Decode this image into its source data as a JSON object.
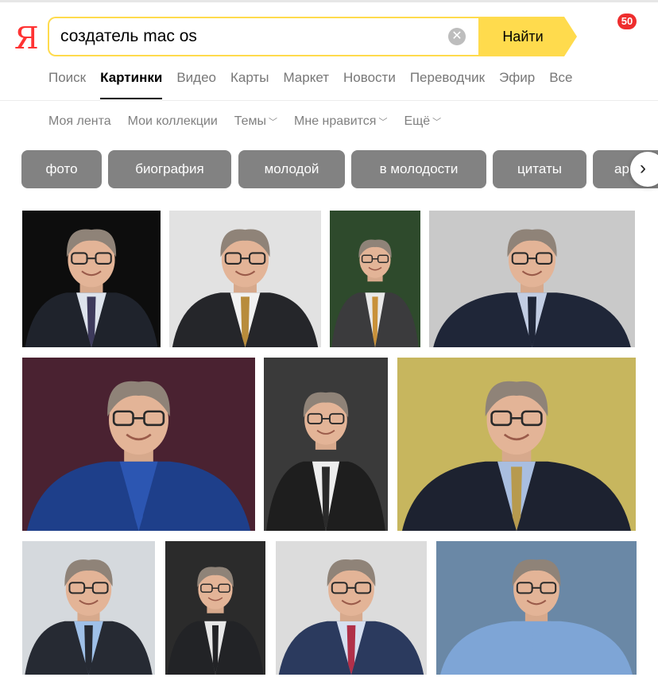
{
  "logo": "Я",
  "search": {
    "value": "создатель mac os",
    "button_label": "Найти"
  },
  "notifications": {
    "count": "50"
  },
  "tabs": [
    {
      "label": "Поиск",
      "active": false
    },
    {
      "label": "Картинки",
      "active": true
    },
    {
      "label": "Видео",
      "active": false
    },
    {
      "label": "Карты",
      "active": false
    },
    {
      "label": "Маркет",
      "active": false
    },
    {
      "label": "Новости",
      "active": false
    },
    {
      "label": "Переводчик",
      "active": false
    },
    {
      "label": "Эфир",
      "active": false
    },
    {
      "label": "Все",
      "active": false
    }
  ],
  "subnav": [
    {
      "label": "Моя лента",
      "dropdown": false
    },
    {
      "label": "Мои коллекции",
      "dropdown": false
    },
    {
      "label": "Темы",
      "dropdown": true
    },
    {
      "label": "Мне нравится",
      "dropdown": true
    },
    {
      "label": "Ещё",
      "dropdown": true
    }
  ],
  "chips": [
    "фото",
    "биография",
    "молодой",
    "в молодости",
    "цитаты",
    "ар"
  ],
  "colors": {
    "accent": "#ffdb4d",
    "logo": "#ff3333",
    "chip": "#828282",
    "badge": "#ee2d2d"
  },
  "images": [
    {
      "bg": "#0d0d0d",
      "suit": "#1f232c",
      "shirt": "#dde3ec",
      "tie": "#3d3a5c"
    },
    {
      "bg": "#e2e2e2",
      "suit": "#25262a",
      "shirt": "#f1f1f1",
      "tie": "#b88c3c"
    },
    {
      "bg": "#2e4a2c",
      "suit": "#3b3b3d",
      "shirt": "#e9e9e9",
      "tie": "#c8913a"
    },
    {
      "bg": "#c9c9c9",
      "suit": "#1f2638",
      "shirt": "#c2cde3",
      "tie": "#1f2638"
    },
    {
      "bg": "#4a2231",
      "suit": "#1e3f8a",
      "shirt": "#2c56b2",
      "tie": "#2c56b2"
    },
    {
      "bg": "#3a3a3a",
      "suit": "#1e1e1e",
      "shirt": "#eeeeee",
      "tie": "#2a2a2a"
    },
    {
      "bg": "#c7b65e",
      "suit": "#1d2230",
      "shirt": "#a9bee0",
      "tie": "#b79a4e"
    },
    {
      "bg": "#d5d9dd",
      "suit": "#262a33",
      "shirt": "#9fc0e8",
      "tie": "#262a33"
    },
    {
      "bg": "#2b2b2b",
      "suit": "#222326",
      "shirt": "#e8e8e8",
      "tie": "#222326"
    },
    {
      "bg": "#dcdcdc",
      "suit": "#2b3a5e",
      "shirt": "#d6dff0",
      "tie": "#b0304a"
    },
    {
      "bg": "#6a88a6",
      "suit": "#7ea5d6",
      "shirt": "#7ea5d6",
      "tie": "#7ea5d6"
    }
  ]
}
